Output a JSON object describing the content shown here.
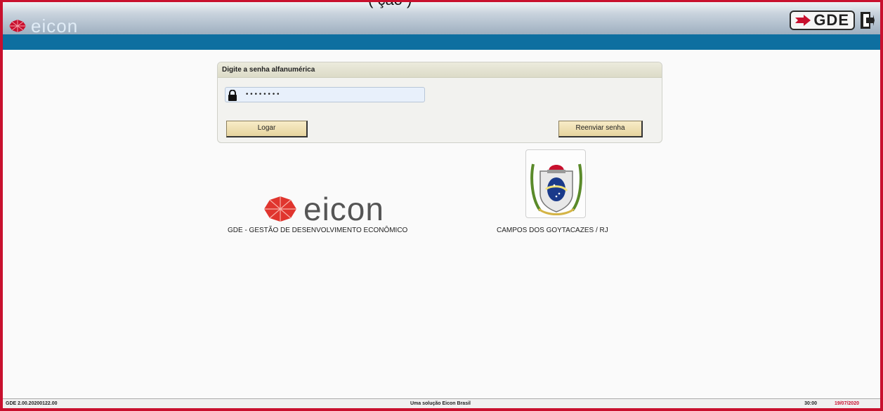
{
  "header": {
    "brand": "eicon",
    "product_badge": "GDE",
    "overflow_text": "(                                                               ção             )"
  },
  "login_panel": {
    "title": "Digite a senha alfanumérica",
    "password_value": "••••••••",
    "login_label": "Logar",
    "resend_label": "Reenviar senha"
  },
  "branding": {
    "logo_text": "eicon",
    "caption": "GDE - GESTÃO DE DESENVOLVIMENTO ECONÔMICO"
  },
  "municipality": {
    "crest_icon": "city-crest-icon",
    "caption": "CAMPOS DOS GOYTACAZES / RJ"
  },
  "footer": {
    "version": "GDE 2.00.20200122.00",
    "tagline": "Uma solução Eicon Brasil",
    "time": "30:00",
    "date": "19/07/2020"
  },
  "colors": {
    "frame_border": "#c8102e",
    "blue_bar": "#0e6fa0",
    "brand_red": "#c8102e"
  }
}
